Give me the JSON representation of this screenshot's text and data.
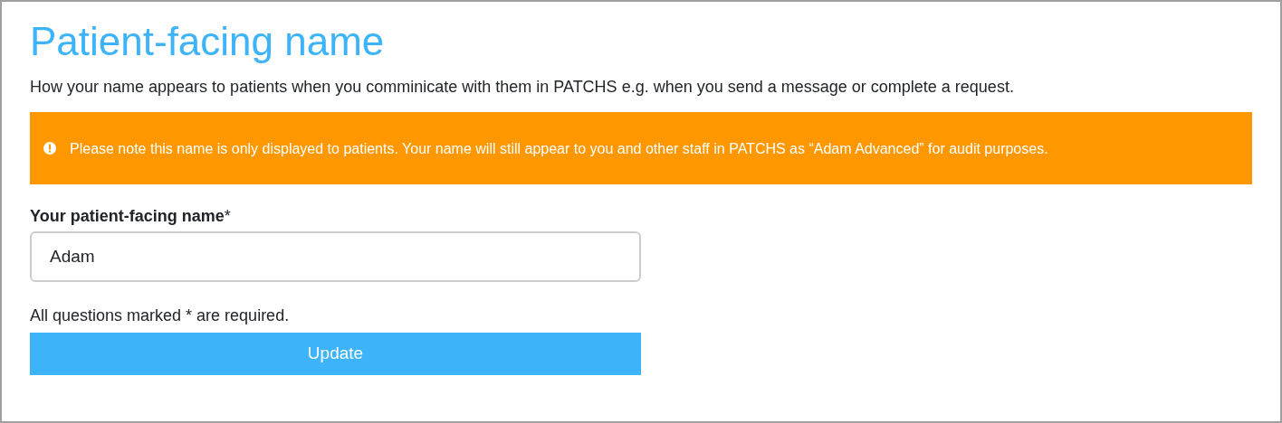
{
  "title": "Patient-facing name",
  "description": "How your name appears to patients when you comminicate with them in PATCHS e.g. when you send a message or complete a request.",
  "alert": {
    "text": "Please note this name is only displayed to patients. Your name will still appear to you and other staff in PATCHS as “Adam Advanced” for audit purposes."
  },
  "field": {
    "label": "Your patient-facing name",
    "required_mark": "*",
    "value": "Adam"
  },
  "note": "All questions marked * are required.",
  "button": {
    "label": "Update"
  }
}
